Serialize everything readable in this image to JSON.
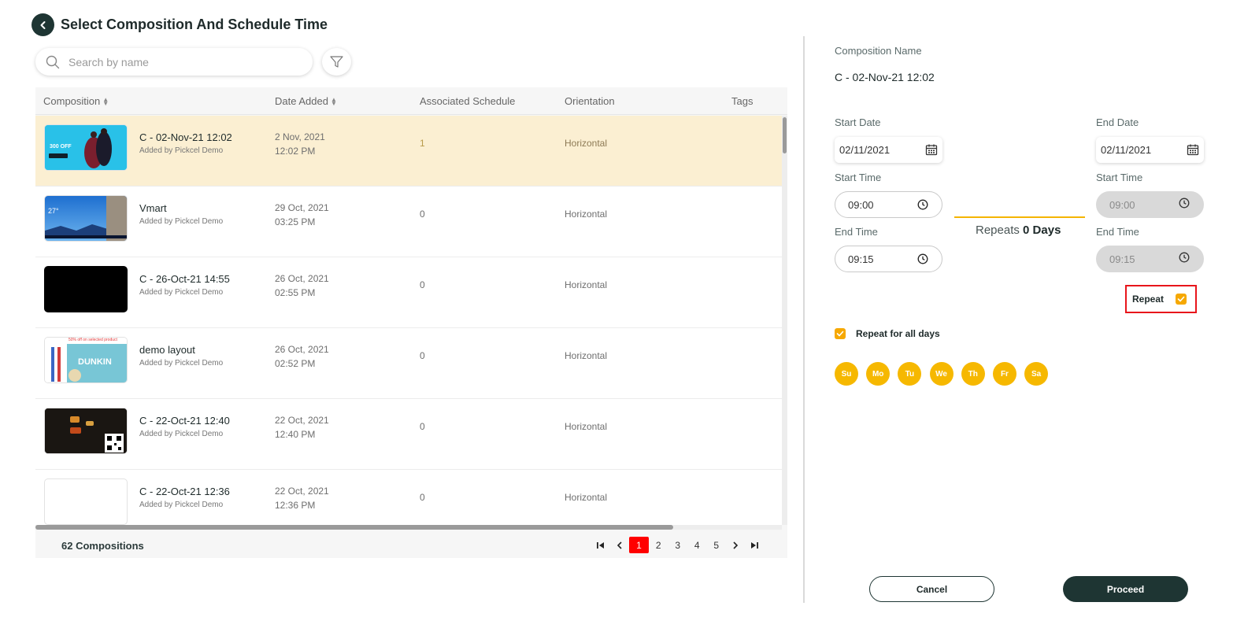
{
  "header": {
    "title": "Select Composition And Schedule Time"
  },
  "search": {
    "placeholder": "Search by name"
  },
  "table": {
    "columns": {
      "composition": "Composition",
      "date_added": "Date Added",
      "associated_schedule": "Associated Schedule",
      "orientation": "Orientation",
      "tags": "Tags"
    },
    "rows": [
      {
        "name": "C - 02-Nov-21 12:02",
        "added_by": "Added by Pickcel Demo",
        "date": "2 Nov, 2021",
        "time": "12:02 PM",
        "associated": "1",
        "orientation": "Horizontal"
      },
      {
        "name": "Vmart",
        "added_by": "Added by Pickcel Demo",
        "date": "29 Oct, 2021",
        "time": "03:25 PM",
        "associated": "0",
        "orientation": "Horizontal"
      },
      {
        "name": "C - 26-Oct-21 14:55",
        "added_by": "Added by Pickcel Demo",
        "date": "26 Oct, 2021",
        "time": "02:55 PM",
        "associated": "0",
        "orientation": "Horizontal"
      },
      {
        "name": "demo layout",
        "added_by": "Added by Pickcel Demo",
        "date": "26 Oct, 2021",
        "time": "02:52 PM",
        "associated": "0",
        "orientation": "Horizontal"
      },
      {
        "name": "C - 22-Oct-21 12:40",
        "added_by": "Added by Pickcel Demo",
        "date": "22 Oct, 2021",
        "time": "12:40 PM",
        "associated": "0",
        "orientation": "Horizontal"
      },
      {
        "name": "C - 22-Oct-21 12:36",
        "added_by": "Added by Pickcel Demo",
        "date": "22 Oct, 2021",
        "time": "12:36 PM",
        "associated": "0",
        "orientation": "Horizontal"
      }
    ],
    "thumb_texts": {
      "promo_1": "300 OFF",
      "weather_temp": "27°",
      "demo_banner": "50% off on selected product",
      "demo_brand": "DUNKIN"
    },
    "footer": {
      "count": "62 Compositions"
    },
    "pagination": {
      "pages": [
        "1",
        "2",
        "3",
        "4",
        "5"
      ],
      "current": "1"
    }
  },
  "panel": {
    "composition_name_label": "Composition Name",
    "composition_name": "C - 02-Nov-21 12:02",
    "start_date_label": "Start Date",
    "start_date": "02/11/2021",
    "end_date_label": "End Date",
    "end_date": "02/11/2021",
    "start_time_label": "Start Time",
    "start_time": "09:00",
    "end_time_label": "End Time",
    "end_time": "09:15",
    "end_start_time_label": "Start Time",
    "end_start_time": "09:00",
    "end_end_time_label": "End Time",
    "end_end_time": "09:15",
    "repeats_prefix": "Repeats",
    "repeats_value": "0 Days",
    "repeat_label": "Repeat",
    "repeat_checked": true,
    "repeat_all_label": "Repeat for all days",
    "repeat_all_checked": true,
    "days": [
      "Su",
      "Mo",
      "Tu",
      "We",
      "Th",
      "Fr",
      "Sa"
    ],
    "cancel_label": "Cancel",
    "proceed_label": "Proceed"
  },
  "colors": {
    "accent": "#f6b800",
    "dark": "#1e3533",
    "selected_row": "#fbefd2",
    "active_page": "#ff0000"
  }
}
